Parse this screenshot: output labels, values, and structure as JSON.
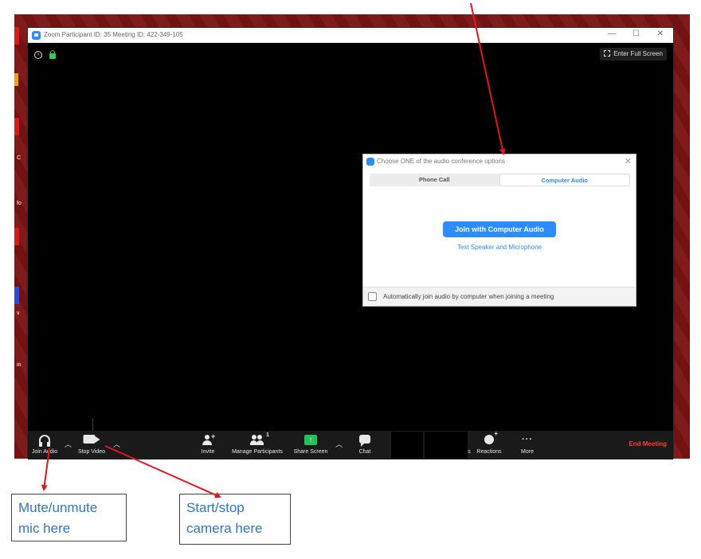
{
  "window": {
    "title": "Zoom Participant ID: 35   Meeting ID: 422-349-105",
    "minimize": "—",
    "maximize": "☐",
    "close": "✕"
  },
  "meeting": {
    "info_icon": "i",
    "fullscreen_label": "Enter Full Screen"
  },
  "dialog": {
    "title": "Choose ONE of the audio conference options",
    "close": "✕",
    "tabs": [
      {
        "label": "Phone Call",
        "active": false
      },
      {
        "label": "Computer Audio",
        "active": true
      }
    ],
    "join_button": "Join with Computer Audio",
    "test_link": "Test Speaker and Microphone",
    "auto_join_label": "Automatically join audio by computer when joining a meeting"
  },
  "toolbar": {
    "join_audio": "Join Audio",
    "stop_video": "Stop Video",
    "invite": "Invite",
    "manage_participants": "Manage Participants",
    "participant_count": "1",
    "share_screen": "Share Screen",
    "chat": "Chat",
    "reactions_prefix": "s",
    "reactions": "Reactions",
    "more": "More",
    "more_glyph": "···",
    "end_meeting": "End Meeting"
  },
  "desktop": {
    "labels": [
      "C",
      "fo",
      "v",
      "in"
    ]
  },
  "annotations": {
    "mic": "Mute/unmute mic here",
    "camera": "Start/stop camera here"
  },
  "colors": {
    "zoom_blue": "#2d8cff",
    "arrow_red": "#e8141b",
    "end_red": "#ff3b3b",
    "share_green": "#23c15a"
  }
}
